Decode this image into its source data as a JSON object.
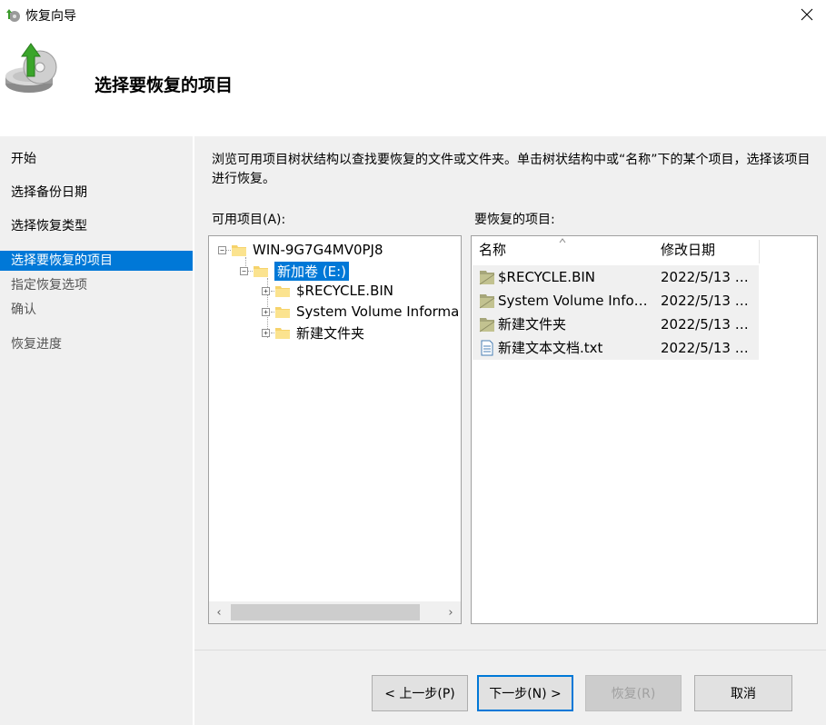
{
  "window": {
    "title": "恢复向导"
  },
  "header": {
    "title": "选择要恢复的项目"
  },
  "nav": {
    "items": [
      {
        "label": "开始"
      },
      {
        "label": "选择备份日期"
      },
      {
        "label": "选择恢复类型"
      },
      {
        "label": "选择要恢复的项目"
      },
      {
        "label": "指定恢复选项"
      },
      {
        "label": "确认"
      },
      {
        "label": "恢复进度"
      }
    ]
  },
  "main": {
    "description": "浏览可用项目树状结构以查找要恢复的文件或文件夹。单击树状结构中或“名称”下的某个项目，选择该项目进行恢复。",
    "available_label": "可用项目(A):",
    "restore_label": "要恢复的项目:"
  },
  "tree": {
    "root": "WIN-9G7G4MV0PJ8",
    "volume": "新加卷 (E:)",
    "children": [
      "$RECYCLE.BIN",
      "System Volume Informa",
      "新建文件夹"
    ]
  },
  "list": {
    "columns": {
      "name": "名称",
      "modified": "修改日期"
    },
    "rows": [
      {
        "name": "$RECYCLE.BIN",
        "date": "2022/5/13 1...",
        "icon": "folder-system-icon"
      },
      {
        "name": "System Volume Inform...",
        "date": "2022/5/13 1...",
        "icon": "folder-system-icon"
      },
      {
        "name": "新建文件夹",
        "date": "2022/5/13 1...",
        "icon": "folder-system-icon"
      },
      {
        "name": "新建文本文档.txt",
        "date": "2022/5/13 1...",
        "icon": "text-file-icon"
      }
    ]
  },
  "buttons": {
    "back": "< 上一步(P)",
    "next": "下一步(N) >",
    "restore": "恢复(R)",
    "cancel": "取消"
  },
  "colors": {
    "accent": "#0078d7",
    "panel": "#f0f0f0"
  }
}
